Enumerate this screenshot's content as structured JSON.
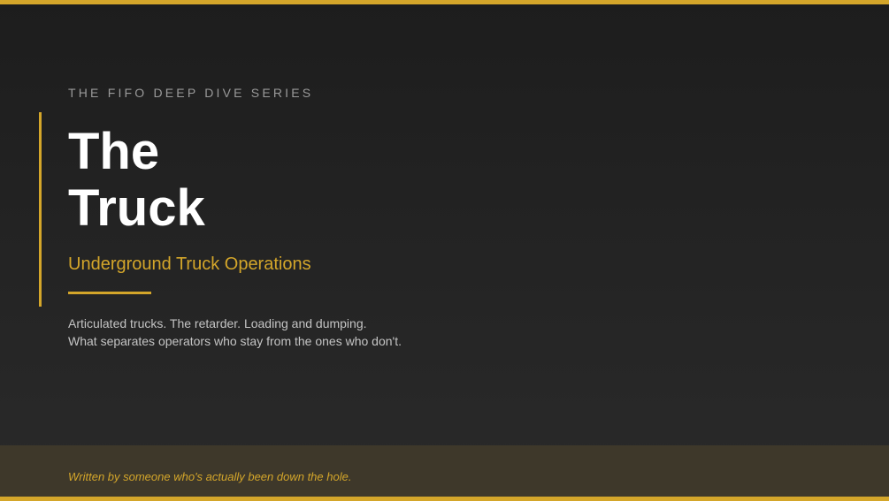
{
  "header": {
    "series_label": "THE FIFO DEEP DIVE SERIES",
    "title_line1": "The",
    "title_line2": "Truck",
    "subtitle": "Underground Truck Operations"
  },
  "description": {
    "line1": "Articulated trucks. The retarder. Loading and dumping.",
    "line2": "What separates operators who stay from the ones who don't."
  },
  "footer": {
    "tagline": "Written by someone who's actually been down the hole."
  },
  "colors": {
    "accent": "#d4a62a",
    "background": "#232323",
    "footer_background": "#3e382a",
    "title": "#ffffff",
    "body_text": "#c4c4c4",
    "muted_text": "#9a9a9a"
  }
}
